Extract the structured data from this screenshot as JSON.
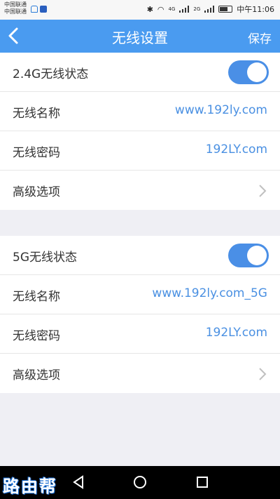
{
  "statusbar": {
    "carrier1": "中国联通",
    "carrier2": "中国联通",
    "time": "中午11:06",
    "net1": "4G",
    "net2": "2G"
  },
  "header": {
    "title": "无线设置",
    "save_label": "保存"
  },
  "band24": {
    "status_label": "2.4G无线状态",
    "enabled": true,
    "ssid_label": "无线名称",
    "ssid_value": "www.192ly.com",
    "password_label": "无线密码",
    "password_value": "192LY.com",
    "advanced_label": "高级选项"
  },
  "band5": {
    "status_label": "5G无线状态",
    "enabled": true,
    "ssid_label": "无线名称",
    "ssid_value": "www.192ly.com_5G",
    "password_label": "无线密码",
    "password_value": "192LY.com",
    "advanced_label": "高级选项"
  },
  "watermark": "路由帮",
  "colors": {
    "accent": "#4a9bf0",
    "value_text": "#4a90e2",
    "background": "#efeff4"
  }
}
